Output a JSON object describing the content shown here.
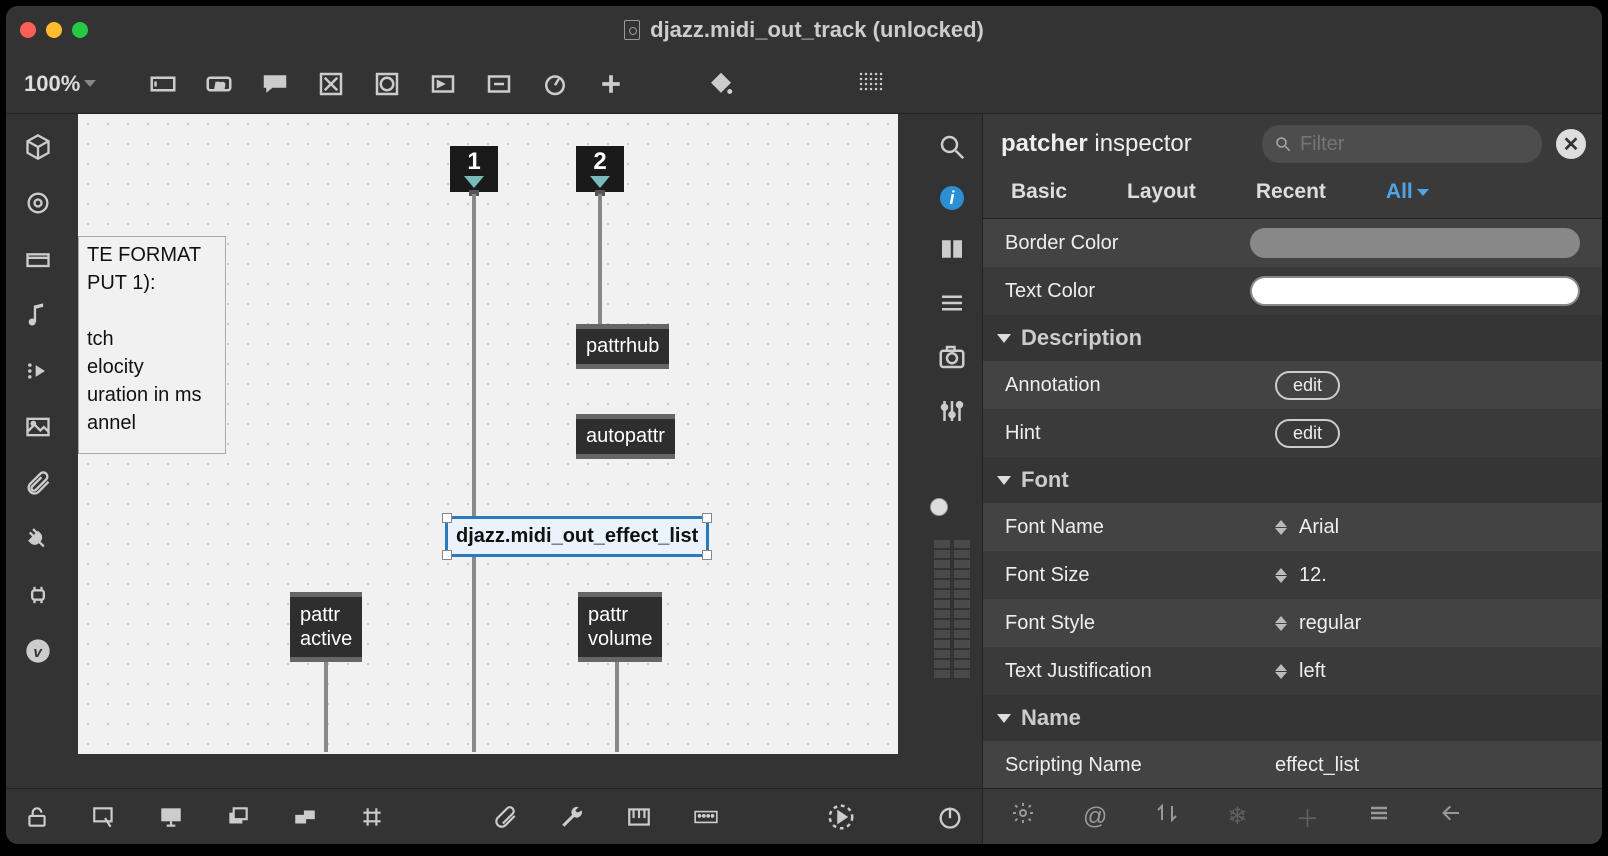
{
  "window": {
    "title": "djazz.midi_out_track (unlocked)"
  },
  "toolbar": {
    "zoom": "100%"
  },
  "canvas": {
    "comment": "TE FORMAT\nPUT 1):\n\ntch\nelocity\nuration in ms\nannel",
    "inlet1": "1",
    "inlet2": "2",
    "obj_pattrhub": "pattrhub",
    "obj_autopattr": "autopattr",
    "obj_effect_list": "djazz.midi_out_effect_list",
    "obj_pattr_active": "pattr\nactive",
    "obj_pattr_volume": "pattr\nvolume"
  },
  "inspector": {
    "title_bold": "patcher",
    "title_rest": " inspector",
    "filter_placeholder": "Filter",
    "tabs": {
      "basic": "Basic",
      "layout": "Layout",
      "recent": "Recent",
      "all": "All"
    },
    "rows": {
      "border_color_label": "Border Color",
      "border_color_value": "#888888",
      "text_color_label": "Text Color",
      "text_color_value": "#ffffff",
      "section_description": "Description",
      "annotation_label": "Annotation",
      "annotation_action": "edit",
      "hint_label": "Hint",
      "hint_action": "edit",
      "section_font": "Font",
      "font_name_label": "Font Name",
      "font_name_value": "Arial",
      "font_size_label": "Font Size",
      "font_size_value": "12.",
      "font_style_label": "Font Style",
      "font_style_value": "regular",
      "text_just_label": "Text Justification",
      "text_just_value": "left",
      "section_name": "Name",
      "scripting_name_label": "Scripting Name",
      "scripting_name_value": "effect_list"
    }
  }
}
